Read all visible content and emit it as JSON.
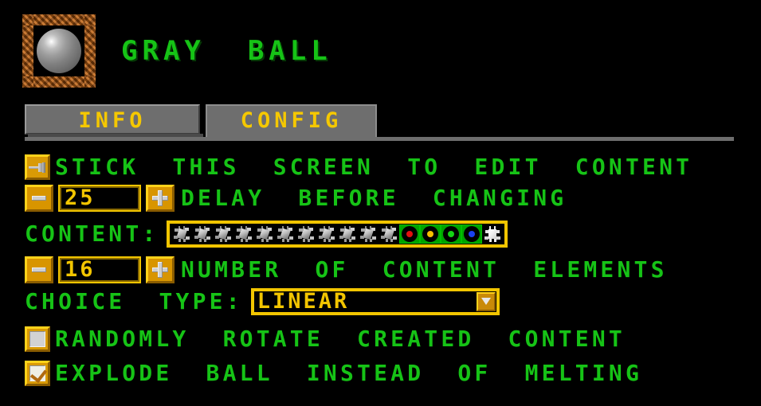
{
  "header": {
    "title": "GRAY  BALL",
    "icon_name": "gray-ball-sprite"
  },
  "tabs": [
    {
      "label": "INFO",
      "active": false
    },
    {
      "label": "CONFIG",
      "active": true
    }
  ],
  "rows": {
    "stick": {
      "icon": "pin-icon",
      "label": "STICK  THIS  SCREEN  TO  EDIT  CONTENT",
      "checked": true
    },
    "delay": {
      "minus_label": "-",
      "plus_label": "+",
      "value": "25",
      "label": "DELAY  BEFORE  CHANGING"
    },
    "content": {
      "label": "CONTENT:",
      "tiles": [
        {
          "type": "bug",
          "color": "#b9b9b9"
        },
        {
          "type": "bug",
          "color": "#b9b9b9"
        },
        {
          "type": "bug",
          "color": "#b9b9b9"
        },
        {
          "type": "bug",
          "color": "#b9b9b9"
        },
        {
          "type": "bug",
          "color": "#b9b9b9"
        },
        {
          "type": "bug",
          "color": "#b9b9b9"
        },
        {
          "type": "bug",
          "color": "#b9b9b9"
        },
        {
          "type": "bug",
          "color": "#b9b9b9"
        },
        {
          "type": "bug",
          "color": "#b9b9b9"
        },
        {
          "type": "bug",
          "color": "#b9b9b9"
        },
        {
          "type": "bug",
          "color": "#b9b9b9"
        },
        {
          "type": "dot",
          "color": "#e01010"
        },
        {
          "type": "dot",
          "color": "#f5c000"
        },
        {
          "type": "dot",
          "color": "#14d414"
        },
        {
          "type": "dot",
          "color": "#1a40f0"
        },
        {
          "type": "bug-white",
          "color": "#f2f2f2"
        }
      ]
    },
    "count": {
      "minus_label": "-",
      "plus_label": "+",
      "value": "16",
      "label": "NUMBER  OF  CONTENT  ELEMENTS"
    },
    "choice": {
      "label": "CHOICE  TYPE:",
      "value": "LINEAR",
      "arrow_icon": "chevron-down-icon"
    },
    "rotate": {
      "label": "RANDOMLY  ROTATE  CREATED  CONTENT",
      "checked": false
    },
    "explode": {
      "label": "EXPLODE  BALL  INSTEAD  OF  MELTING",
      "checked": true
    }
  },
  "colors": {
    "background": "#000000",
    "green_text": "#16c316",
    "yellow_text": "#f2c500",
    "tab_face": "#6e6e6e",
    "orange_button": "#d89500",
    "rust_border": "#b35c11"
  }
}
